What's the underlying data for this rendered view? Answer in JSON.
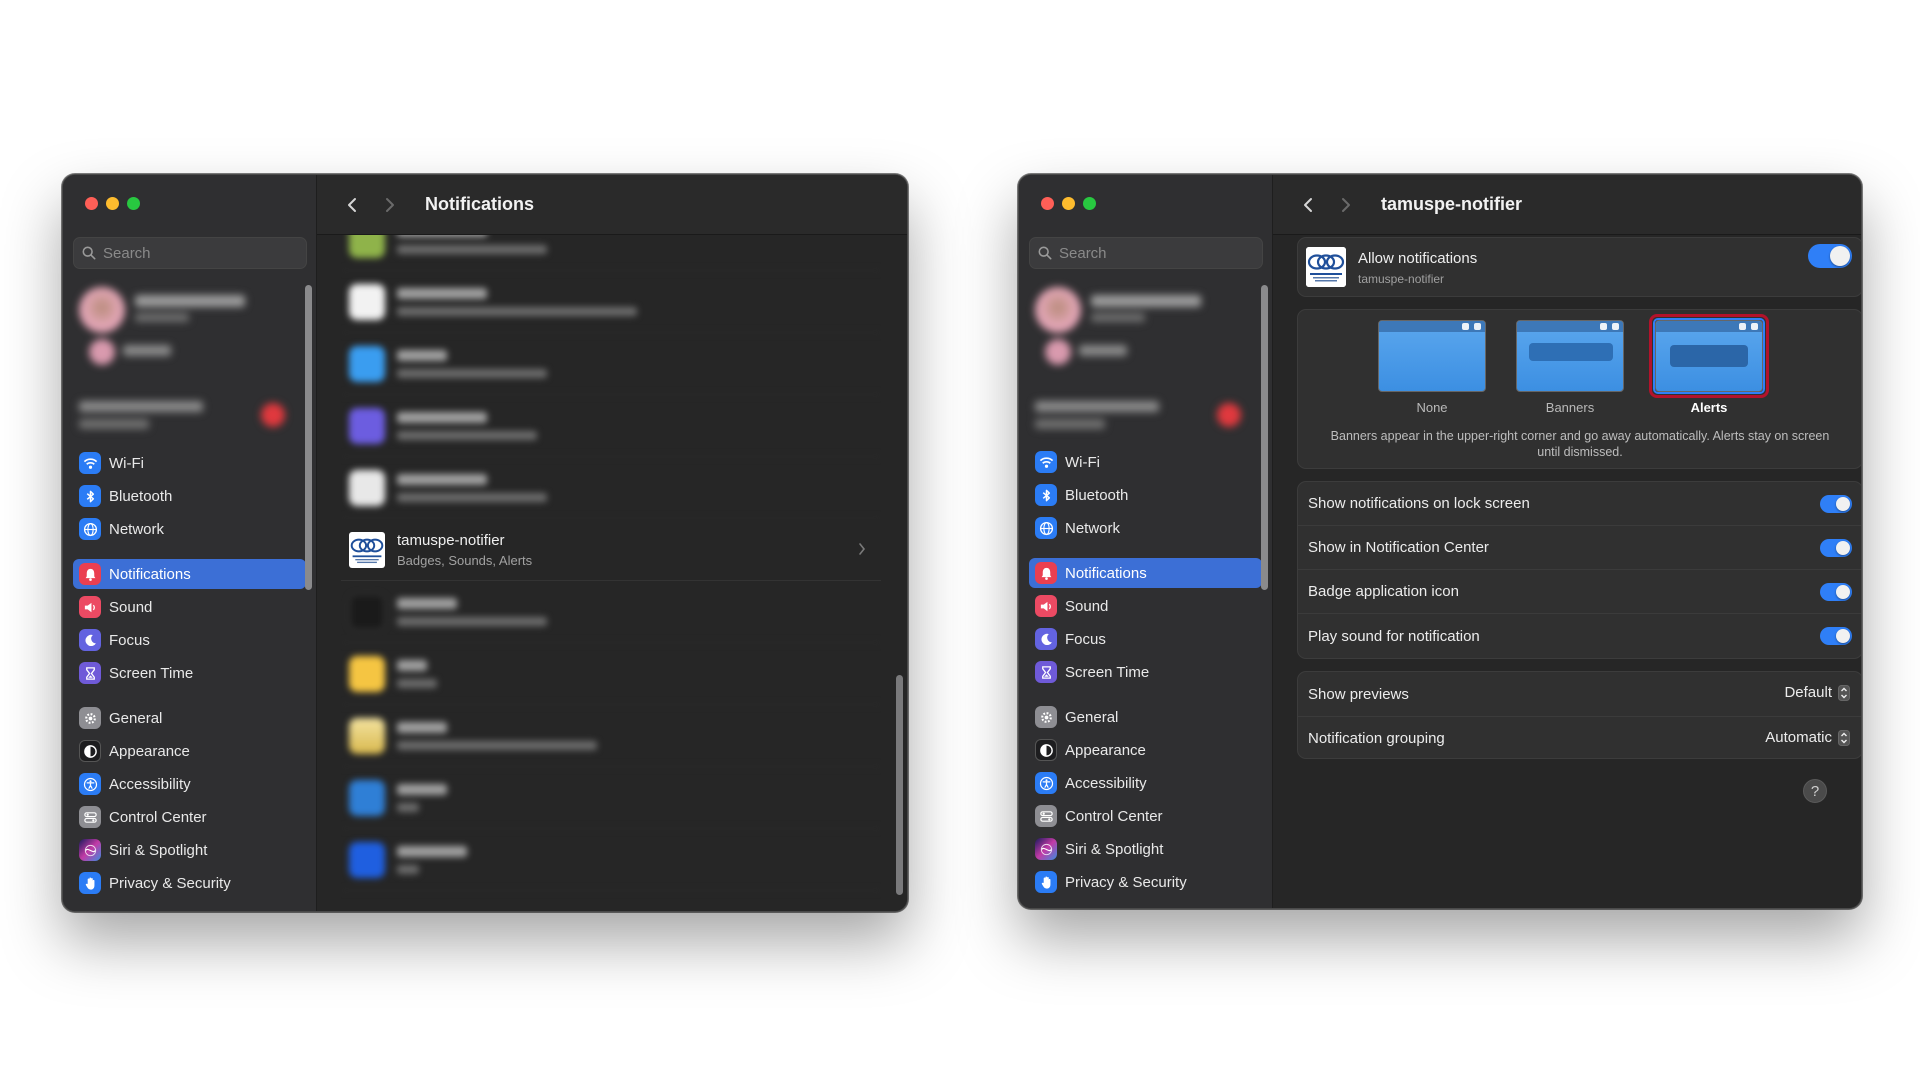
{
  "sidebar": {
    "search_placeholder": "Search",
    "group1": [
      {
        "label": "Wi-Fi",
        "icon": "wifi-icon"
      },
      {
        "label": "Bluetooth",
        "icon": "bluetooth-icon"
      },
      {
        "label": "Network",
        "icon": "globe-icon"
      }
    ],
    "group2": [
      {
        "label": "Notifications",
        "icon": "bell-icon",
        "active": true
      },
      {
        "label": "Sound",
        "icon": "speaker-icon"
      },
      {
        "label": "Focus",
        "icon": "moon-icon"
      },
      {
        "label": "Screen Time",
        "icon": "hourglass-icon"
      }
    ],
    "group3": [
      {
        "label": "General",
        "icon": "gear-icon"
      },
      {
        "label": "Appearance",
        "icon": "appearance-icon"
      },
      {
        "label": "Accessibility",
        "icon": "accessibility-icon"
      },
      {
        "label": "Control Center",
        "icon": "control-center-icon"
      },
      {
        "label": "Siri & Spotlight",
        "icon": "siri-icon"
      },
      {
        "label": "Privacy & Security",
        "icon": "hand-icon"
      }
    ]
  },
  "left_window": {
    "title": "Notifications",
    "app_row": {
      "name": "tamuspe-notifier",
      "subtitle": "Badges, Sounds, Alerts"
    }
  },
  "right_window": {
    "title": "tamuspe-notifier",
    "allow": {
      "label": "Allow notifications",
      "subtitle": "tamuspe-notifier",
      "enabled": true
    },
    "styles": [
      {
        "label": "None"
      },
      {
        "label": "Banners"
      },
      {
        "label": "Alerts",
        "selected": true
      }
    ],
    "style_description": "Banners appear in the upper-right corner and go away automatically. Alerts stay on screen until dismissed.",
    "toggles": [
      {
        "label": "Show notifications on lock screen",
        "on": true
      },
      {
        "label": "Show in Notification Center",
        "on": true
      },
      {
        "label": "Badge application icon",
        "on": true
      },
      {
        "label": "Play sound for notification",
        "on": true
      }
    ],
    "selects": [
      {
        "label": "Show previews",
        "value": "Default"
      },
      {
        "label": "Notification grouping",
        "value": "Automatic"
      }
    ],
    "help": "?"
  },
  "colors": {
    "accent": "#3c6fd6",
    "toggle_on": "#2f7ff7",
    "highlight_frame": "#b3122b"
  }
}
